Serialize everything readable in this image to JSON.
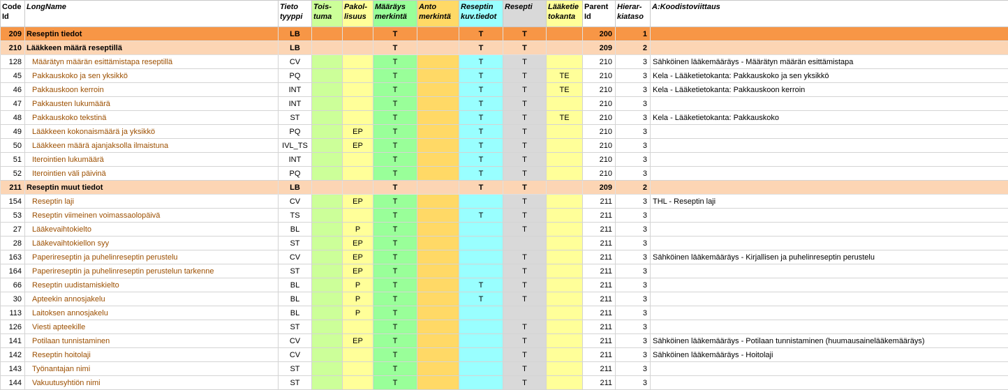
{
  "headers": {
    "code": "Code Id",
    "code_l1": "Code",
    "code_l2": "Id",
    "longname": "LongName",
    "tieto_l1": "Tieto",
    "tieto_l2": "tyyppi",
    "toistuma_l1": "Tois-",
    "toistuma_l2": "tuma",
    "pakol_l1": "Pakol-",
    "pakol_l2": "lisuus",
    "maar_l1": "Määräys",
    "maar_l2": "merkintä",
    "anto_l1": "Anto",
    "anto_l2": "merkintä",
    "resk_l1": "Reseptin",
    "resk_l2": "kuv.tiedot",
    "resepti": "Resepti",
    "laake_l1": "Lääketie",
    "laake_l2": "tokanta",
    "parent_l1": "Parent",
    "parent_l2": "Id",
    "hier_l1": "Hierar-",
    "hier_l2": "kiataso",
    "ref": "A:Koodistoviittaus"
  },
  "rows": [
    {
      "style": "group1",
      "code": "209",
      "name": "Reseptin tiedot",
      "type": "LB",
      "toistuma": "",
      "pakol": "",
      "maar": "T",
      "anto": "",
      "resk": "T",
      "resepti": "T",
      "laake": "",
      "parent": "200",
      "hier": "1",
      "ref": ""
    },
    {
      "style": "group2",
      "code": "210",
      "name": "Lääkkeen määrä reseptillä",
      "type": "LB",
      "toistuma": "",
      "pakol": "",
      "maar": "T",
      "anto": "",
      "resk": "T",
      "resepti": "T",
      "laake": "",
      "parent": "209",
      "hier": "2",
      "ref": ""
    },
    {
      "style": "item",
      "code": "128",
      "name": "Määrätyn määrän esittämistapa reseptillä",
      "type": "CV",
      "toistuma": "",
      "pakol": "",
      "maar": "T",
      "anto": "",
      "resk": "T",
      "resepti": "T",
      "laake": "",
      "parent": "210",
      "hier": "3",
      "ref": "Sähköinen lääkemääräys - Määrätyn määrän esittämistapa"
    },
    {
      "style": "item",
      "code": "45",
      "name": "Pakkauskoko ja sen yksikkö",
      "type": "PQ",
      "toistuma": "",
      "pakol": "",
      "maar": "T",
      "anto": "",
      "resk": "T",
      "resepti": "T",
      "laake": "TE",
      "parent": "210",
      "hier": "3",
      "ref": "Kela - Lääketietokanta: Pakkauskoko ja sen yksikkö"
    },
    {
      "style": "item",
      "code": "46",
      "name": "Pakkauskoon kerroin",
      "type": "INT",
      "toistuma": "",
      "pakol": "",
      "maar": "T",
      "anto": "",
      "resk": "T",
      "resepti": "T",
      "laake": "TE",
      "parent": "210",
      "hier": "3",
      "ref": "Kela - Lääketietokanta: Pakkauskoon kerroin"
    },
    {
      "style": "item",
      "code": "47",
      "name": "Pakkausten lukumäärä",
      "type": "INT",
      "toistuma": "",
      "pakol": "",
      "maar": "T",
      "anto": "",
      "resk": "T",
      "resepti": "T",
      "laake": "",
      "parent": "210",
      "hier": "3",
      "ref": ""
    },
    {
      "style": "item",
      "code": "48",
      "name": "Pakkauskoko tekstinä",
      "type": "ST",
      "toistuma": "",
      "pakol": "",
      "maar": "T",
      "anto": "",
      "resk": "T",
      "resepti": "T",
      "laake": "TE",
      "parent": "210",
      "hier": "3",
      "ref": "Kela - Lääketietokanta: Pakkauskoko"
    },
    {
      "style": "item",
      "code": "49",
      "name": "Lääkkeen kokonaismäärä ja yksikkö",
      "type": "PQ",
      "toistuma": "",
      "pakol": "EP",
      "maar": "T",
      "anto": "",
      "resk": "T",
      "resepti": "T",
      "laake": "",
      "parent": "210",
      "hier": "3",
      "ref": ""
    },
    {
      "style": "item",
      "code": "50",
      "name": "Lääkkeen määrä ajanjaksolla ilmaistuna",
      "type": "IVL_TS",
      "toistuma": "",
      "pakol": "EP",
      "maar": "T",
      "anto": "",
      "resk": "T",
      "resepti": "T",
      "laake": "",
      "parent": "210",
      "hier": "3",
      "ref": ""
    },
    {
      "style": "item",
      "code": "51",
      "name": "Iterointien lukumäärä",
      "type": "INT",
      "toistuma": "",
      "pakol": "",
      "maar": "T",
      "anto": "",
      "resk": "T",
      "resepti": "T",
      "laake": "",
      "parent": "210",
      "hier": "3",
      "ref": ""
    },
    {
      "style": "item",
      "code": "52",
      "name": "Iterointien väli päivinä",
      "type": "PQ",
      "toistuma": "",
      "pakol": "",
      "maar": "T",
      "anto": "",
      "resk": "T",
      "resepti": "T",
      "laake": "",
      "parent": "210",
      "hier": "3",
      "ref": ""
    },
    {
      "style": "group2",
      "code": "211",
      "name": "Reseptin muut tiedot",
      "type": "LB",
      "toistuma": "",
      "pakol": "",
      "maar": "T",
      "anto": "",
      "resk": "T",
      "resepti": "T",
      "laake": "",
      "parent": "209",
      "hier": "2",
      "ref": ""
    },
    {
      "style": "item",
      "code": "154",
      "name": "Reseptin laji",
      "type": "CV",
      "toistuma": "",
      "pakol": "EP",
      "maar": "T",
      "anto": "",
      "resk": "",
      "resepti": "T",
      "laake": "",
      "parent": "211",
      "hier": "3",
      "ref": "THL - Reseptin laji"
    },
    {
      "style": "item",
      "code": "53",
      "name": "Reseptin viimeinen voimassaolopäivä",
      "type": "TS",
      "toistuma": "",
      "pakol": "",
      "maar": "T",
      "anto": "",
      "resk": "T",
      "resepti": "T",
      "laake": "",
      "parent": "211",
      "hier": "3",
      "ref": ""
    },
    {
      "style": "item",
      "code": "27",
      "name": "Lääkevaihtokielto",
      "type": "BL",
      "toistuma": "",
      "pakol": "P",
      "maar": "T",
      "anto": "",
      "resk": "",
      "resepti": "T",
      "laake": "",
      "parent": "211",
      "hier": "3",
      "ref": ""
    },
    {
      "style": "item",
      "code": "28",
      "name": "Lääkevaihtokiellon syy",
      "type": "ST",
      "toistuma": "",
      "pakol": "EP",
      "maar": "T",
      "anto": "",
      "resk": "",
      "resepti": "",
      "laake": "",
      "parent": "211",
      "hier": "3",
      "ref": ""
    },
    {
      "style": "item",
      "code": "163",
      "name": "Paperireseptin ja puhelinreseptin perustelu",
      "type": "CV",
      "toistuma": "",
      "pakol": "EP",
      "maar": "T",
      "anto": "",
      "resk": "",
      "resepti": "T",
      "laake": "",
      "parent": "211",
      "hier": "3",
      "ref": "Sähköinen lääkemääräys - Kirjallisen ja puhelinreseptin perustelu"
    },
    {
      "style": "item",
      "code": "164",
      "name": "Paperireseptin ja puhelinreseptin perustelun tarkenne",
      "type": "ST",
      "toistuma": "",
      "pakol": "EP",
      "maar": "T",
      "anto": "",
      "resk": "",
      "resepti": "T",
      "laake": "",
      "parent": "211",
      "hier": "3",
      "ref": ""
    },
    {
      "style": "item",
      "code": "66",
      "name": "Reseptin uudistamiskielto",
      "type": "BL",
      "toistuma": "",
      "pakol": "P",
      "maar": "T",
      "anto": "",
      "resk": "T",
      "resepti": "T",
      "laake": "",
      "parent": "211",
      "hier": "3",
      "ref": ""
    },
    {
      "style": "item",
      "code": "30",
      "name": "Apteekin annosjakelu",
      "type": "BL",
      "toistuma": "",
      "pakol": "P",
      "maar": "T",
      "anto": "",
      "resk": "T",
      "resepti": "T",
      "laake": "",
      "parent": "211",
      "hier": "3",
      "ref": ""
    },
    {
      "style": "item",
      "code": "113",
      "name": "Laitoksen annosjakelu",
      "type": "BL",
      "toistuma": "",
      "pakol": "P",
      "maar": "T",
      "anto": "",
      "resk": "",
      "resepti": "",
      "laake": "",
      "parent": "211",
      "hier": "3",
      "ref": ""
    },
    {
      "style": "item",
      "code": "126",
      "name": "Viesti apteekille",
      "type": "ST",
      "toistuma": "",
      "pakol": "",
      "maar": "T",
      "anto": "",
      "resk": "",
      "resepti": "T",
      "laake": "",
      "parent": "211",
      "hier": "3",
      "ref": ""
    },
    {
      "style": "item",
      "code": "141",
      "name": "Potilaan tunnistaminen",
      "type": "CV",
      "toistuma": "",
      "pakol": "EP",
      "maar": "T",
      "anto": "",
      "resk": "",
      "resepti": "T",
      "laake": "",
      "parent": "211",
      "hier": "3",
      "ref": "Sähköinen lääkemääräys - Potilaan tunnistaminen (huumausainelääkemääräys)"
    },
    {
      "style": "item",
      "code": "142",
      "name": "Reseptin hoitolaji",
      "type": "CV",
      "toistuma": "",
      "pakol": "",
      "maar": "T",
      "anto": "",
      "resk": "",
      "resepti": "T",
      "laake": "",
      "parent": "211",
      "hier": "3",
      "ref": "Sähköinen lääkemääräys - Hoitolaji"
    },
    {
      "style": "item",
      "code": "143",
      "name": "Työnantajan nimi",
      "type": "ST",
      "toistuma": "",
      "pakol": "",
      "maar": "T",
      "anto": "",
      "resk": "",
      "resepti": "T",
      "laake": "",
      "parent": "211",
      "hier": "3",
      "ref": ""
    },
    {
      "style": "item",
      "code": "144",
      "name": "Vakuutusyhtiön nimi",
      "type": "ST",
      "toistuma": "",
      "pakol": "",
      "maar": "T",
      "anto": "",
      "resk": "",
      "resepti": "T",
      "laake": "",
      "parent": "211",
      "hier": "3",
      "ref": ""
    }
  ]
}
